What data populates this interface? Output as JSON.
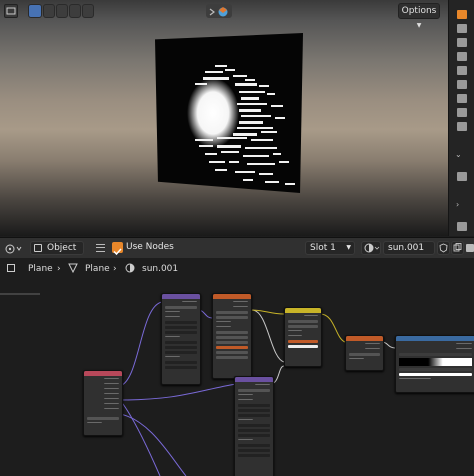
{
  "viewport": {
    "options_label": "Options"
  },
  "node_editor_header": {
    "object_mode": "Object",
    "use_nodes_label": "Use Nodes",
    "use_nodes_checked": true,
    "slot": "Slot 1",
    "material_name": "sun.001"
  },
  "breadcrumb": {
    "item1": "Plane",
    "item2": "Plane",
    "item3": "sun.001"
  },
  "colors": {
    "accent": "#4772b3",
    "checkbox": "#e8872a",
    "texture_coord_header": "#b8485a",
    "mapping_header": "#6a50a0",
    "noise_header": "#c05a28",
    "mixrgb_header": "#c8b428",
    "gradient_header": "#c05a28",
    "colorramp_header": "#3a6aa0"
  }
}
